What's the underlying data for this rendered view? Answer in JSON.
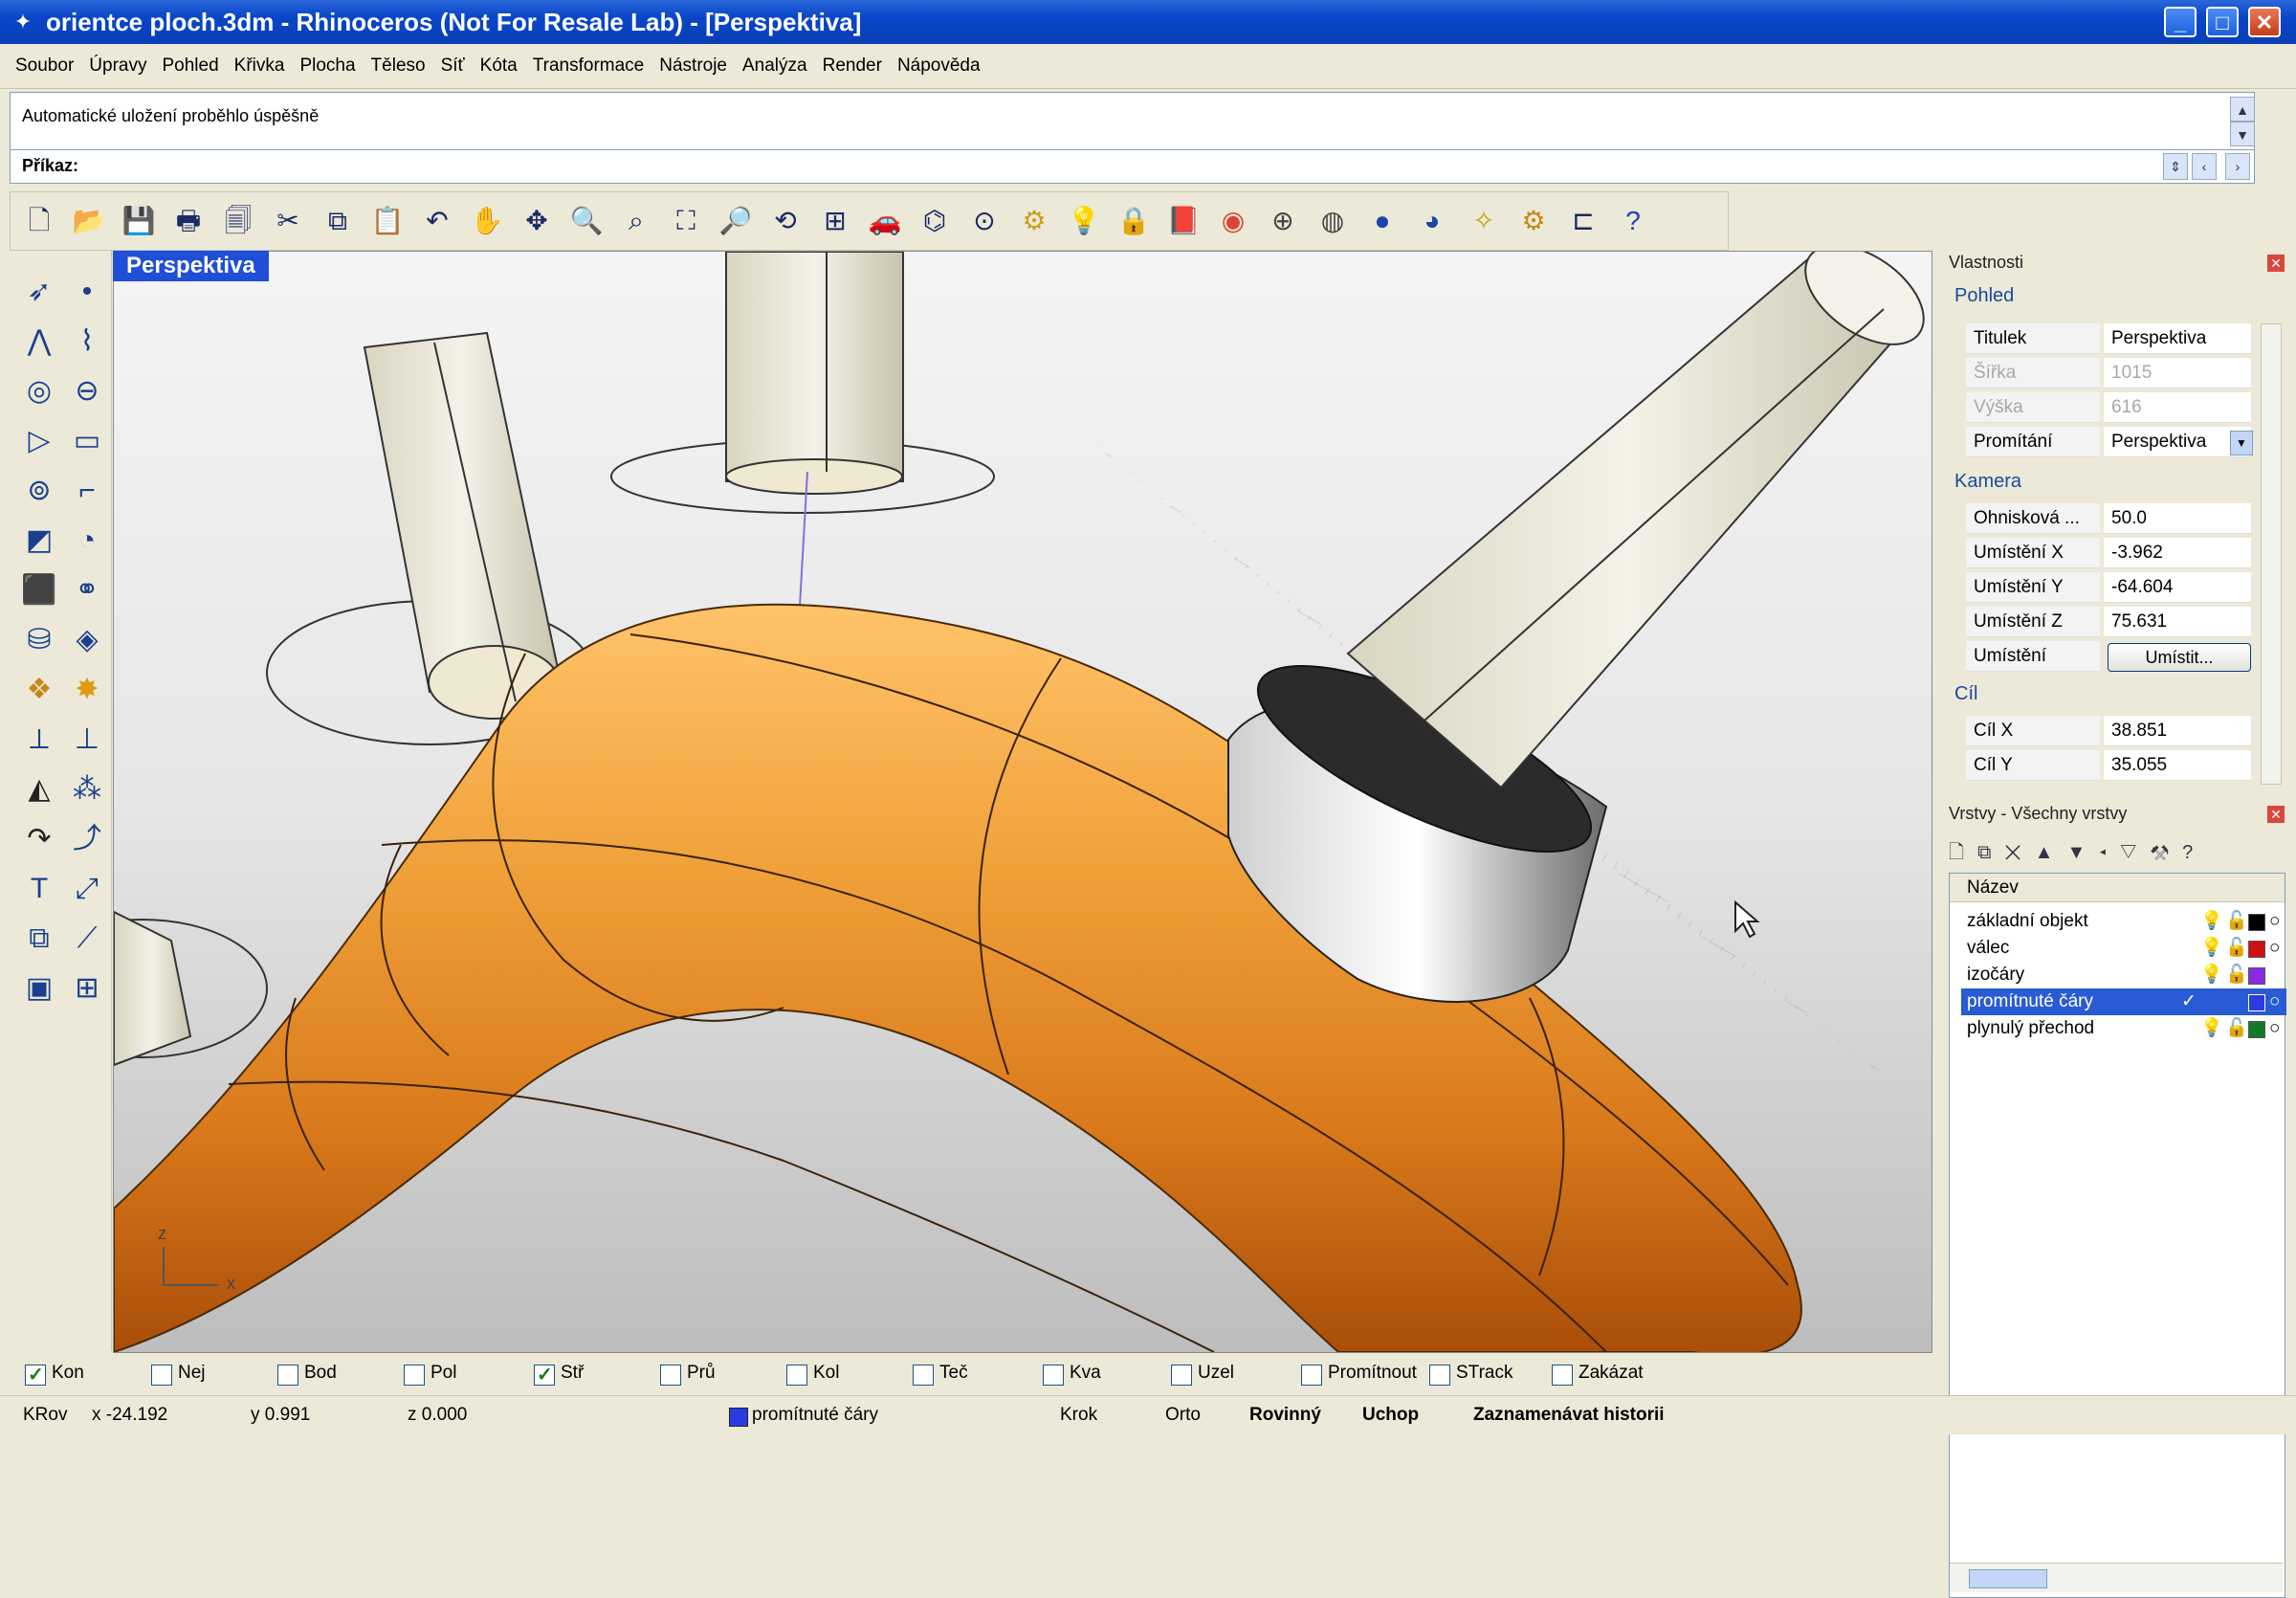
{
  "window": {
    "title": "orientce ploch.3dm - Rhinoceros (Not For Resale Lab) - [Perspektiva]",
    "controls": [
      "_",
      "□",
      "✕"
    ]
  },
  "menu": [
    "Soubor",
    "Úpravy",
    "Pohled",
    "Křivka",
    "Plocha",
    "Těleso",
    "Síť",
    "Kóta",
    "Transformace",
    "Nástroje",
    "Analýza",
    "Render",
    "Nápověda"
  ],
  "command": {
    "history": "Automatické uložení proběhlo úspěšně",
    "prompt_label": "Příkaz:"
  },
  "viewport": {
    "title": "Perspektiva",
    "axis_x": "x",
    "axis_z": "z"
  },
  "properties": {
    "panel_title": "Vlastnosti",
    "section_view": "Pohled",
    "rows_view": [
      {
        "k": "Titulek",
        "v": "Perspektiva",
        "disabled": false
      },
      {
        "k": "Šířka",
        "v": "1015",
        "disabled": true
      },
      {
        "k": "Výška",
        "v": "616",
        "disabled": true
      },
      {
        "k": "Promítání",
        "v": "Perspektiva",
        "disabled": false
      }
    ],
    "section_camera": "Kamera",
    "rows_camera": [
      {
        "k": "Ohnisková ...",
        "v": "50.0"
      },
      {
        "k": "Umístění X",
        "v": "-3.962"
      },
      {
        "k": "Umístění Y",
        "v": "-64.604"
      },
      {
        "k": "Umístění Z",
        "v": "75.631"
      },
      {
        "k": "Umístění",
        "v": "Umístit..."
      }
    ],
    "section_target": "Cíl",
    "rows_target": [
      {
        "k": "Cíl X",
        "v": "38.851"
      },
      {
        "k": "Cíl Y",
        "v": "35.055"
      }
    ]
  },
  "layers": {
    "panel_title": "Vrstvy - Všechny vrstvy",
    "column_header": "Název",
    "rows": [
      {
        "name": "základní objekt",
        "color": "#000000",
        "selected": false
      },
      {
        "name": "válec",
        "color": "#d01010",
        "selected": false
      },
      {
        "name": "izočáry",
        "color": "#8a2be2",
        "selected": false
      },
      {
        "name": "promítnuté čáry",
        "color": "#2a3be0",
        "selected": true
      },
      {
        "name": "plynulý přechod",
        "color": "#117a2a",
        "selected": false
      }
    ]
  },
  "osnaps": [
    {
      "label": "Kon",
      "checked": true
    },
    {
      "label": "Nej",
      "checked": false
    },
    {
      "label": "Bod",
      "checked": false
    },
    {
      "label": "Pol",
      "checked": false
    },
    {
      "label": "Stř",
      "checked": true
    },
    {
      "label": "Prů",
      "checked": false
    },
    {
      "label": "Kol",
      "checked": false
    },
    {
      "label": "Teč",
      "checked": false
    },
    {
      "label": "Kva",
      "checked": false
    },
    {
      "label": "Uzel",
      "checked": false
    },
    {
      "label": "Promítnout",
      "checked": false
    },
    {
      "label": "STrack",
      "checked": false
    },
    {
      "label": "Zakázat",
      "checked": false
    }
  ],
  "status": {
    "cplane": "KRov",
    "x": "x -24.192",
    "y": "y 0.991",
    "z": "z 0.000",
    "layer": "promítnuté čáry",
    "layer_color": "#2a3be0",
    "snap": "Krok",
    "ortho": "Orto",
    "planar": "Rovinný",
    "osnap": "Uchop",
    "history": "Zaznamenávat historii"
  }
}
